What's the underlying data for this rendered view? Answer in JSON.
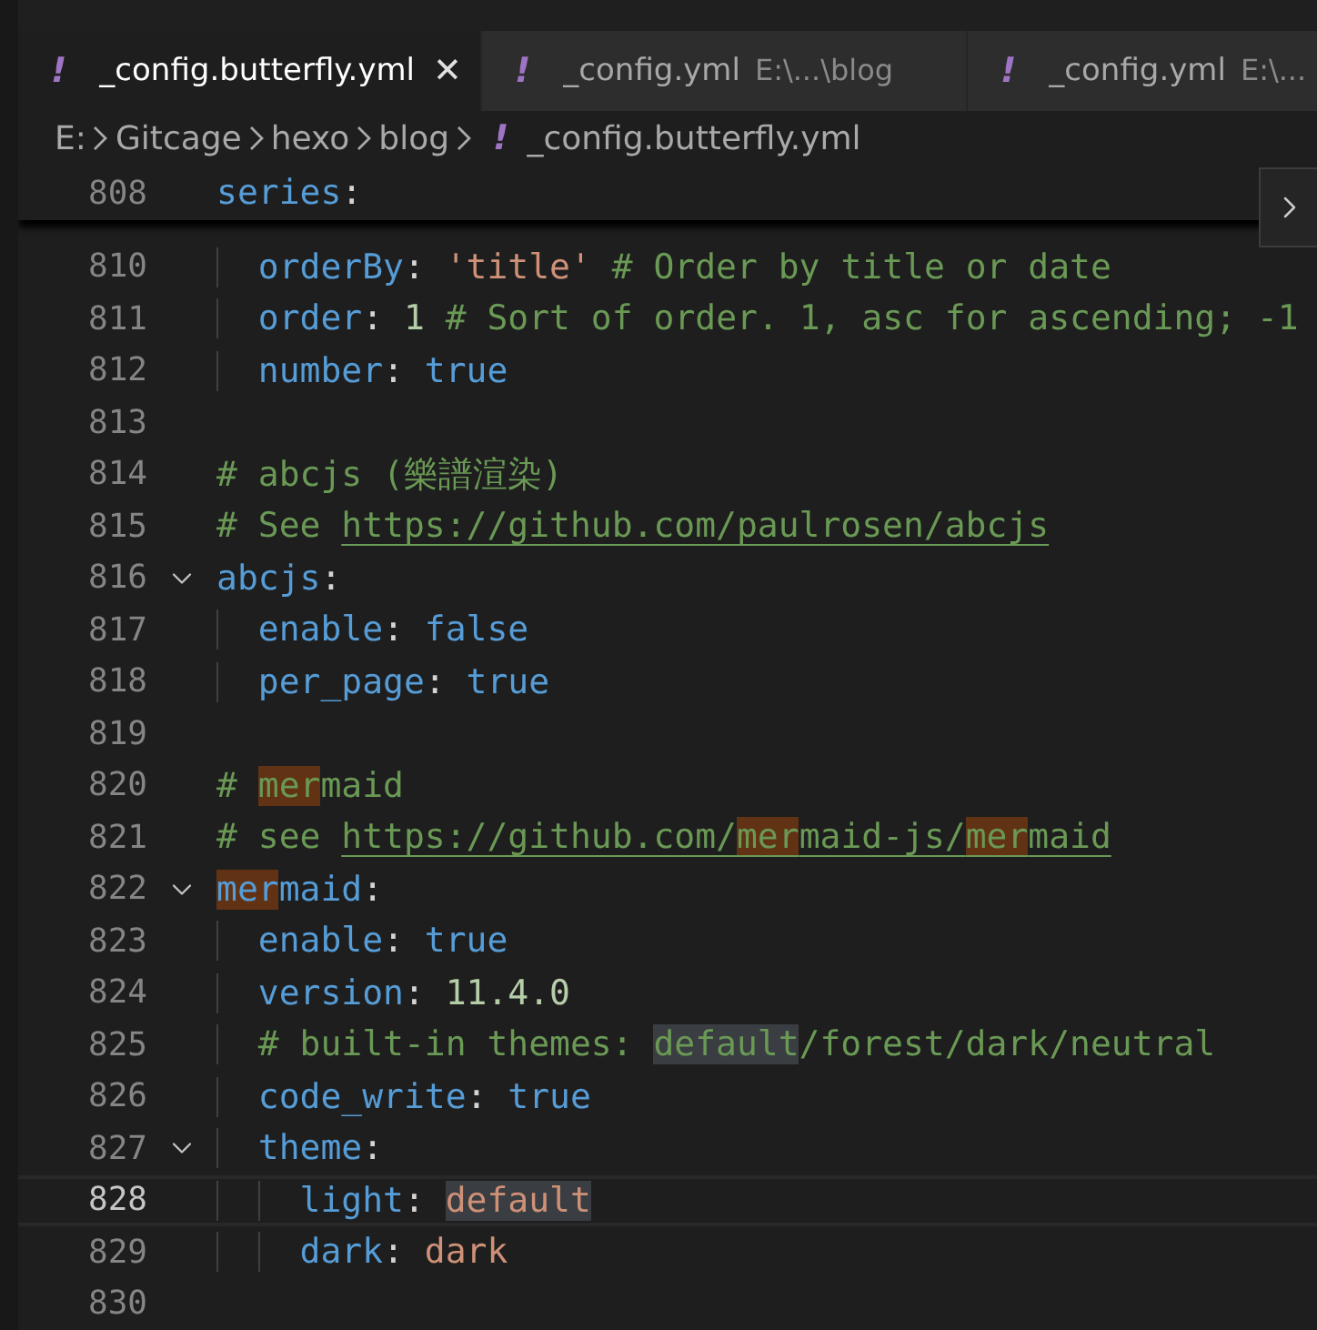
{
  "tabs": [
    {
      "icon": "!",
      "label": "_config.butterfly.yml",
      "selected": true,
      "close": "✕"
    },
    {
      "icon": "!",
      "label": "_config.yml",
      "detail": "E:\\...\\blog",
      "selected": false
    },
    {
      "icon": "!",
      "label": "_config.yml",
      "detail": "E:\\...",
      "selected": false
    }
  ],
  "breadcrumb": [
    {
      "label": "E:"
    },
    {
      "label": "Gitcage"
    },
    {
      "label": "hexo"
    },
    {
      "label": "blog"
    },
    {
      "label": "_config.butterfly.yml",
      "icon": "!"
    }
  ],
  "sticky_line": {
    "number": "808",
    "tokens": [
      {
        "kind": "key",
        "text": "series"
      },
      {
        "kind": "punct",
        "text": ":"
      }
    ]
  },
  "lines": [
    {
      "number": "810",
      "fold": false,
      "current": false,
      "tokens": [
        {
          "kind": "key",
          "text": "  orderBy"
        },
        {
          "kind": "punct",
          "text": ": "
        },
        {
          "kind": "string",
          "text": "'title'"
        },
        {
          "kind": "comment",
          "text": " # Order by title or date"
        }
      ]
    },
    {
      "number": "811",
      "fold": false,
      "current": false,
      "tokens": [
        {
          "kind": "key",
          "text": "  order"
        },
        {
          "kind": "punct",
          "text": ": "
        },
        {
          "kind": "number",
          "text": "1"
        },
        {
          "kind": "comment",
          "text": " # Sort of order. 1, asc for ascending; -1"
        }
      ]
    },
    {
      "number": "812",
      "fold": false,
      "current": false,
      "tokens": [
        {
          "kind": "key",
          "text": "  number"
        },
        {
          "kind": "punct",
          "text": ": "
        },
        {
          "kind": "bool",
          "text": "true"
        }
      ]
    },
    {
      "number": "813",
      "fold": false,
      "current": false
    },
    {
      "number": "814",
      "fold": false,
      "current": false,
      "tokens": [
        {
          "kind": "comment",
          "text": "# abcjs (樂譜渲染)"
        }
      ]
    },
    {
      "number": "815",
      "fold": false,
      "current": false,
      "tokens": [
        {
          "kind": "comment",
          "text": "# See "
        },
        {
          "kind": "link",
          "text": "https://github.com/paulrosen/abcjs"
        }
      ]
    },
    {
      "number": "816",
      "fold": true,
      "current": false,
      "tokens": [
        {
          "kind": "key",
          "text": "abcjs"
        },
        {
          "kind": "punct",
          "text": ":"
        }
      ]
    },
    {
      "number": "817",
      "fold": false,
      "current": false,
      "tokens": [
        {
          "kind": "key",
          "text": "  enable"
        },
        {
          "kind": "punct",
          "text": ": "
        },
        {
          "kind": "bool",
          "text": "false"
        }
      ]
    },
    {
      "number": "818",
      "fold": false,
      "current": false,
      "tokens": [
        {
          "kind": "key",
          "text": "  per_page"
        },
        {
          "kind": "punct",
          "text": ": "
        },
        {
          "kind": "bool",
          "text": "true"
        }
      ]
    },
    {
      "number": "819",
      "fold": false,
      "current": false
    },
    {
      "number": "820",
      "fold": false,
      "current": false,
      "tokens": [
        {
          "kind": "comment",
          "text": "# "
        },
        {
          "kind": "comment",
          "text": "mer",
          "search_match": true
        },
        {
          "kind": "comment",
          "text": "maid"
        }
      ]
    },
    {
      "number": "821",
      "fold": false,
      "current": false,
      "tokens": [
        {
          "kind": "comment",
          "text": "# see "
        },
        {
          "kind": "link",
          "text": "https://github.com/"
        },
        {
          "kind": "link",
          "text": "mer",
          "search_match": true
        },
        {
          "kind": "link",
          "text": "maid-js/"
        },
        {
          "kind": "link",
          "text": "mer",
          "search_match": true
        },
        {
          "kind": "link",
          "text": "maid"
        }
      ]
    },
    {
      "number": "822",
      "fold": true,
      "current": false,
      "tokens": [
        {
          "kind": "key",
          "text": "mer",
          "search_match": true
        },
        {
          "kind": "key",
          "text": "maid"
        },
        {
          "kind": "punct",
          "text": ":"
        }
      ]
    },
    {
      "number": "823",
      "fold": false,
      "current": false,
      "tokens": [
        {
          "kind": "key",
          "text": "  enable"
        },
        {
          "kind": "punct",
          "text": ": "
        },
        {
          "kind": "bool",
          "text": "true"
        }
      ]
    },
    {
      "number": "824",
      "fold": false,
      "current": false,
      "tokens": [
        {
          "kind": "key",
          "text": "  version"
        },
        {
          "kind": "punct",
          "text": ": "
        },
        {
          "kind": "number",
          "text": "11.4.0"
        }
      ]
    },
    {
      "number": "825",
      "fold": false,
      "current": false,
      "tokens": [
        {
          "kind": "comment",
          "text": "  # built-in themes: "
        },
        {
          "kind": "comment",
          "text": "default",
          "selection_match": true
        },
        {
          "kind": "comment",
          "text": "/forest/dark/neutral"
        }
      ]
    },
    {
      "number": "826",
      "fold": false,
      "current": false,
      "tokens": [
        {
          "kind": "key",
          "text": "  code_write"
        },
        {
          "kind": "punct",
          "text": ": "
        },
        {
          "kind": "bool",
          "text": "true"
        }
      ]
    },
    {
      "number": "827",
      "fold": true,
      "current": false,
      "tokens": [
        {
          "kind": "key",
          "text": "  theme"
        },
        {
          "kind": "punct",
          "text": ":"
        }
      ]
    },
    {
      "number": "828",
      "fold": false,
      "current": true,
      "tokens": [
        {
          "kind": "key",
          "text": "    light"
        },
        {
          "kind": "punct",
          "text": ": "
        },
        {
          "kind": "string",
          "text": "default",
          "selection_match": true
        }
      ]
    },
    {
      "number": "829",
      "fold": false,
      "current": false,
      "tokens": [
        {
          "kind": "key",
          "text": "    dark"
        },
        {
          "kind": "punct",
          "text": ": "
        },
        {
          "kind": "string",
          "text": "dark"
        }
      ]
    },
    {
      "number": "830",
      "fold": false,
      "current": false
    }
  ]
}
